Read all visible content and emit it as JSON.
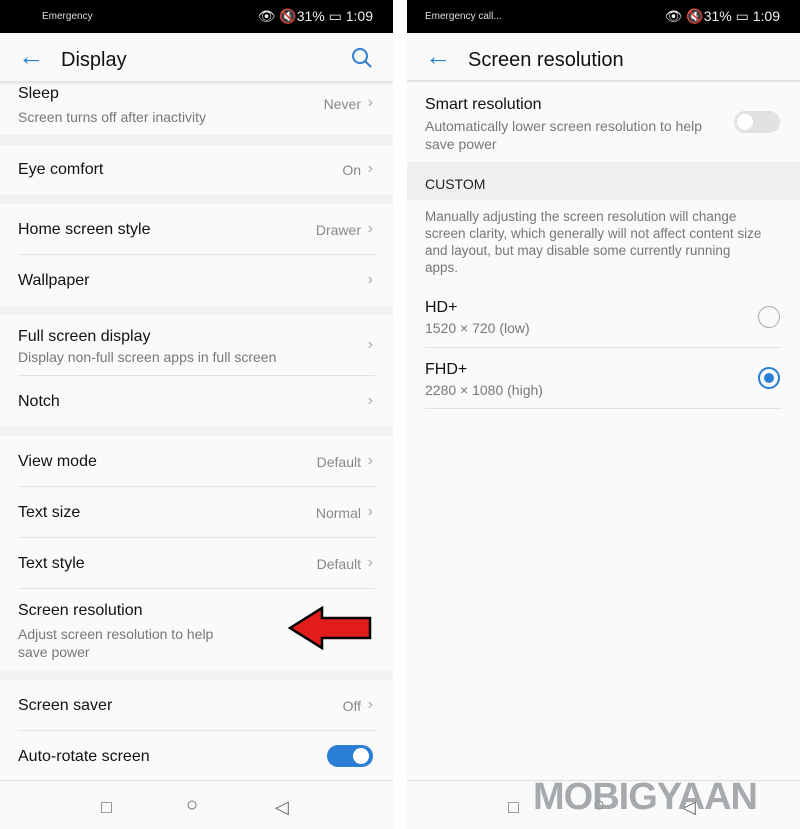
{
  "left": {
    "status": {
      "carrier": "Emergency",
      "battery": "31%",
      "time": "1:09"
    },
    "header": {
      "title": "Display"
    },
    "rows": [
      {
        "label": "Sleep",
        "sub": "Screen turns off after inactivity",
        "value": "Never"
      },
      {
        "label": "Eye comfort",
        "value": "On"
      },
      {
        "label": "Home screen style",
        "value": "Drawer"
      },
      {
        "label": "Wallpaper"
      },
      {
        "label": "Full screen display",
        "sub": "Display non-full screen apps in full screen"
      },
      {
        "label": "Notch"
      },
      {
        "label": "View mode",
        "value": "Default"
      },
      {
        "label": "Text size",
        "value": "Normal"
      },
      {
        "label": "Text style",
        "value": "Default"
      },
      {
        "label": "Screen resolution",
        "sub": "Adjust screen resolution to help save power"
      },
      {
        "label": "Screen saver",
        "value": "Off"
      },
      {
        "label": "Auto-rotate screen",
        "toggle": true
      }
    ]
  },
  "right": {
    "status": {
      "carrier": "Emergency call...",
      "battery": "31%",
      "time": "1:09"
    },
    "header": {
      "title": "Screen resolution"
    },
    "smart": {
      "label": "Smart resolution",
      "sub": "Automatically lower screen resolution to help save power",
      "toggle": false
    },
    "section": "CUSTOM",
    "description": "Manually adjusting the screen resolution will change screen clarity, which generally will not affect content size and layout, but may disable some currently running apps.",
    "options": [
      {
        "label": "HD+",
        "sub": "1520 × 720 (low)",
        "selected": false
      },
      {
        "label": "FHD+",
        "sub": "2280 × 1080 (high)",
        "selected": true
      }
    ]
  },
  "watermark": "MOBIGYAAN",
  "colors": {
    "accent": "#2a7fd4",
    "arrow": "#e21b1b"
  }
}
